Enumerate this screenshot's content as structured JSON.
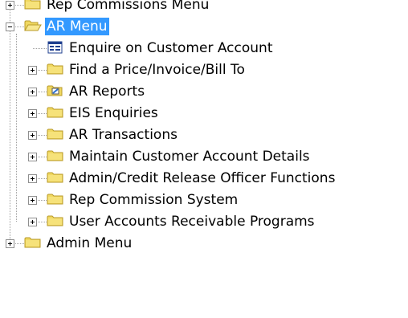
{
  "tree": {
    "items": [
      {
        "label": "Rep Commissions Menu",
        "level": 0,
        "expander": "plus",
        "icon": "folder-closed-icon",
        "selected": false
      },
      {
        "label": "AR Menu",
        "level": 0,
        "expander": "minus",
        "icon": "folder-open-icon",
        "selected": true
      },
      {
        "label": "Enquire on Customer Account",
        "level": 1,
        "expander": "none",
        "icon": "form-window-icon",
        "selected": false
      },
      {
        "label": "Find a Price/Invoice/Bill To",
        "level": 1,
        "expander": "plus",
        "icon": "folder-closed-icon",
        "selected": false
      },
      {
        "label": "AR Reports",
        "level": 1,
        "expander": "plus",
        "icon": "report-folder-icon",
        "selected": false
      },
      {
        "label": "EIS Enquiries",
        "level": 1,
        "expander": "plus",
        "icon": "folder-closed-icon",
        "selected": false
      },
      {
        "label": "AR Transactions",
        "level": 1,
        "expander": "plus",
        "icon": "folder-closed-icon",
        "selected": false
      },
      {
        "label": "Maintain Customer Account Details",
        "level": 1,
        "expander": "plus",
        "icon": "folder-closed-icon",
        "selected": false
      },
      {
        "label": "Admin/Credit Release Officer Functions",
        "level": 1,
        "expander": "plus",
        "icon": "folder-closed-icon",
        "selected": false
      },
      {
        "label": "Rep Commission System",
        "level": 1,
        "expander": "plus",
        "icon": "folder-closed-icon",
        "selected": false
      },
      {
        "label": "User Accounts Receivable Programs",
        "level": 1,
        "expander": "plus",
        "icon": "folder-closed-icon",
        "selected": false
      },
      {
        "label": "Admin Menu",
        "level": 0,
        "expander": "plus",
        "icon": "folder-closed-icon",
        "selected": false
      }
    ]
  },
  "colors": {
    "selection": "#3399ff",
    "folder_fill": "#f0d860",
    "folder_edge": "#b89a2a"
  }
}
